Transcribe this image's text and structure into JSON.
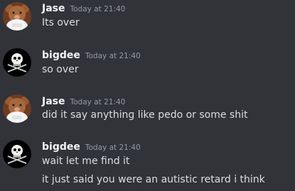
{
  "messages": [
    {
      "author": "Jase",
      "avatar_icon": "teddy-bear-avatar-icon",
      "timestamp": "Today at 21:40",
      "lines": [
        "Its over"
      ]
    },
    {
      "author": "bigdee",
      "avatar_icon": "skull-crossed-swords-avatar-icon",
      "timestamp": "Today at 21:40",
      "lines": [
        "so over"
      ]
    },
    {
      "author": "Jase",
      "avatar_icon": "teddy-bear-avatar-icon",
      "timestamp": "Today at 21:40",
      "lines": [
        "did it say anything like pedo or some shit"
      ]
    },
    {
      "author": "bigdee",
      "avatar_icon": "skull-crossed-swords-avatar-icon",
      "timestamp": "Today at 21:40",
      "lines": [
        "wait let me find it",
        "it just said you were an autistic retard i think"
      ]
    }
  ],
  "colors": {
    "background": "#313338",
    "username": "#f2f3f5",
    "timestamp": "#949ba4",
    "message_text": "#dbdee1"
  }
}
